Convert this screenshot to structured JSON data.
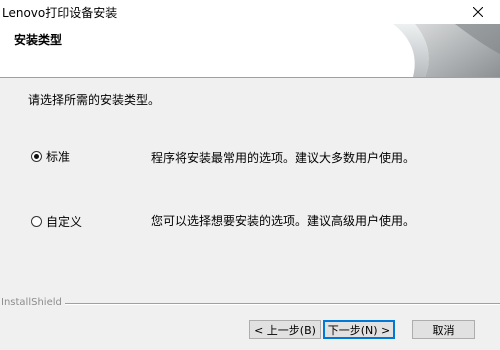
{
  "window": {
    "title": "Lenovo打印设备安装"
  },
  "header": {
    "title": "安装类型"
  },
  "body": {
    "prompt": "请选择所需的安装类型。",
    "options": [
      {
        "label": "标准",
        "description": "程序将安装最常用的选项。建议大多数用户使用。",
        "selected": true
      },
      {
        "label": "自定义",
        "description": "您可以选择想要安装的选项。建议高级用户使用。",
        "selected": false
      }
    ]
  },
  "footer": {
    "brand": "InstallShield",
    "back_label": "< 上一步(B)",
    "next_label": "下一步(N) >",
    "cancel_label": "取消"
  }
}
